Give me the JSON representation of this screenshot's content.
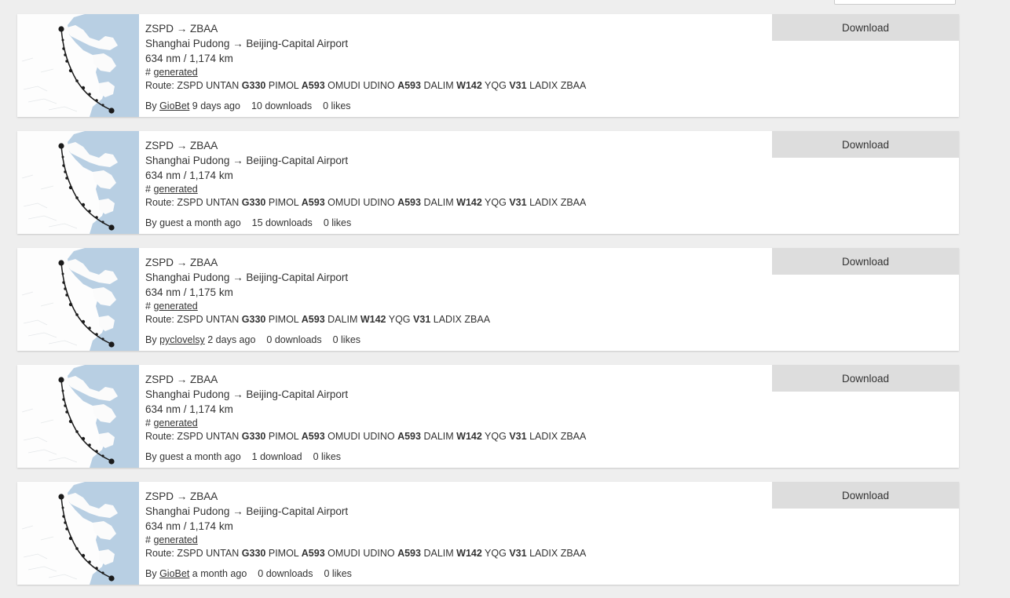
{
  "page": {
    "background_color": "#eeeeee",
    "card_background": "#ffffff",
    "download_button_color": "#dddddd",
    "map_water_color": "#b8cfe3",
    "map_land_color": "#fbfbfb"
  },
  "top_control": {
    "visible_labels": [
      "",
      "",
      "",
      ""
    ]
  },
  "common": {
    "download_label": "Download",
    "route_prefix": "Route:",
    "by_prefix": "By",
    "tag_hash": "#"
  },
  "flights": [
    {
      "icao_pair": "ZSPD → ZBAA",
      "airport_pair": "Shanghai Pudong → Beijing-Capital Airport",
      "distance": "634 nm / 1,174 km",
      "tag": "generated",
      "route_tokens": [
        {
          "text": "ZSPD",
          "bold": false
        },
        {
          "text": "UNTAN",
          "bold": false
        },
        {
          "text": "G330",
          "bold": true
        },
        {
          "text": "PIMOL",
          "bold": false
        },
        {
          "text": "A593",
          "bold": true
        },
        {
          "text": "OMUDI",
          "bold": false
        },
        {
          "text": "UDINO",
          "bold": false
        },
        {
          "text": "A593",
          "bold": true
        },
        {
          "text": "DALIM",
          "bold": false
        },
        {
          "text": "W142",
          "bold": true
        },
        {
          "text": "YQG",
          "bold": false
        },
        {
          "text": "V31",
          "bold": true
        },
        {
          "text": "LADIX",
          "bold": false
        },
        {
          "text": "ZBAA",
          "bold": false
        }
      ],
      "author": "GioBet",
      "author_is_link": true,
      "age": "9 days ago",
      "downloads": "10 downloads",
      "likes": "0 likes",
      "download_label": "Download"
    },
    {
      "icao_pair": "ZSPD → ZBAA",
      "airport_pair": "Shanghai Pudong → Beijing-Capital Airport",
      "distance": "634 nm / 1,174 km",
      "tag": "generated",
      "route_tokens": [
        {
          "text": "ZSPD",
          "bold": false
        },
        {
          "text": "UNTAN",
          "bold": false
        },
        {
          "text": "G330",
          "bold": true
        },
        {
          "text": "PIMOL",
          "bold": false
        },
        {
          "text": "A593",
          "bold": true
        },
        {
          "text": "OMUDI",
          "bold": false
        },
        {
          "text": "UDINO",
          "bold": false
        },
        {
          "text": "A593",
          "bold": true
        },
        {
          "text": "DALIM",
          "bold": false
        },
        {
          "text": "W142",
          "bold": true
        },
        {
          "text": "YQG",
          "bold": false
        },
        {
          "text": "V31",
          "bold": true
        },
        {
          "text": "LADIX",
          "bold": false
        },
        {
          "text": "ZBAA",
          "bold": false
        }
      ],
      "author": "guest",
      "author_is_link": false,
      "age": "a month ago",
      "downloads": "15 downloads",
      "likes": "0 likes",
      "download_label": "Download"
    },
    {
      "icao_pair": "ZSPD → ZBAA",
      "airport_pair": "Shanghai Pudong → Beijing-Capital Airport",
      "distance": "634 nm / 1,175 km",
      "tag": "generated",
      "route_tokens": [
        {
          "text": "ZSPD",
          "bold": false
        },
        {
          "text": "UNTAN",
          "bold": false
        },
        {
          "text": "G330",
          "bold": true
        },
        {
          "text": "PIMOL",
          "bold": false
        },
        {
          "text": "A593",
          "bold": true
        },
        {
          "text": "DALIM",
          "bold": false
        },
        {
          "text": "W142",
          "bold": true
        },
        {
          "text": "YQG",
          "bold": false
        },
        {
          "text": "V31",
          "bold": true
        },
        {
          "text": "LADIX",
          "bold": false
        },
        {
          "text": "ZBAA",
          "bold": false
        }
      ],
      "author": "pyclovelsy",
      "author_is_link": true,
      "age": "2 days ago",
      "downloads": "0 downloads",
      "likes": "0 likes",
      "download_label": "Download"
    },
    {
      "icao_pair": "ZSPD → ZBAA",
      "airport_pair": "Shanghai Pudong → Beijing-Capital Airport",
      "distance": "634 nm / 1,174 km",
      "tag": "generated",
      "route_tokens": [
        {
          "text": "ZSPD",
          "bold": false
        },
        {
          "text": "UNTAN",
          "bold": false
        },
        {
          "text": "G330",
          "bold": true
        },
        {
          "text": "PIMOL",
          "bold": false
        },
        {
          "text": "A593",
          "bold": true
        },
        {
          "text": "OMUDI",
          "bold": false
        },
        {
          "text": "UDINO",
          "bold": false
        },
        {
          "text": "A593",
          "bold": true
        },
        {
          "text": "DALIM",
          "bold": false
        },
        {
          "text": "W142",
          "bold": true
        },
        {
          "text": "YQG",
          "bold": false
        },
        {
          "text": "V31",
          "bold": true
        },
        {
          "text": "LADIX",
          "bold": false
        },
        {
          "text": "ZBAA",
          "bold": false
        }
      ],
      "author": "guest",
      "author_is_link": false,
      "age": "a month ago",
      "downloads": "1 download",
      "likes": "0 likes",
      "download_label": "Download"
    },
    {
      "icao_pair": "ZSPD → ZBAA",
      "airport_pair": "Shanghai Pudong → Beijing-Capital Airport",
      "distance": "634 nm / 1,174 km",
      "tag": "generated",
      "route_tokens": [
        {
          "text": "ZSPD",
          "bold": false
        },
        {
          "text": "UNTAN",
          "bold": false
        },
        {
          "text": "G330",
          "bold": true
        },
        {
          "text": "PIMOL",
          "bold": false
        },
        {
          "text": "A593",
          "bold": true
        },
        {
          "text": "OMUDI",
          "bold": false
        },
        {
          "text": "UDINO",
          "bold": false
        },
        {
          "text": "A593",
          "bold": true
        },
        {
          "text": "DALIM",
          "bold": false
        },
        {
          "text": "W142",
          "bold": true
        },
        {
          "text": "YQG",
          "bold": false
        },
        {
          "text": "V31",
          "bold": true
        },
        {
          "text": "LADIX",
          "bold": false
        },
        {
          "text": "ZBAA",
          "bold": false
        }
      ],
      "author": "GioBet",
      "author_is_link": true,
      "age": "a month ago",
      "downloads": "0 downloads",
      "likes": "0 likes",
      "download_label": "Download"
    }
  ]
}
